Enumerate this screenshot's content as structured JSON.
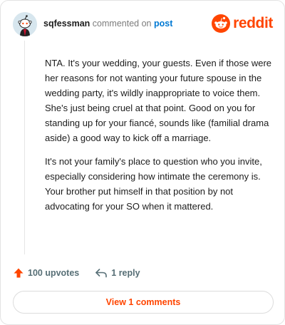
{
  "comment": {
    "username": "sqfessman",
    "action_text": "commented on",
    "post_link": "post",
    "paragraphs": [
      "NTA. It's your wedding, your guests. Even if those were her reasons for not wanting your future spouse in the wedding party, it's wildly inappropriate to voice them. She's just being cruel at that point. Good on you for standing up for your fiancé, sounds like (familial drama aside) a good way to kick off a marriage.",
      "It's not your family's place to question who you invite, especially considering how intimate the ceremony is. Your brother put himself in that position by not advocating for your SO when it mattered."
    ],
    "upvotes_label": "100 upvotes",
    "replies_label": "1 reply"
  },
  "brand": {
    "name": "reddit",
    "icon": "reddit-snoo-icon",
    "color": "#ff4500"
  },
  "footer": {
    "view_comments_label": "View 1 comments"
  },
  "colors": {
    "accent": "#ff4500",
    "link": "#0079d3",
    "muted": "#576f76"
  }
}
